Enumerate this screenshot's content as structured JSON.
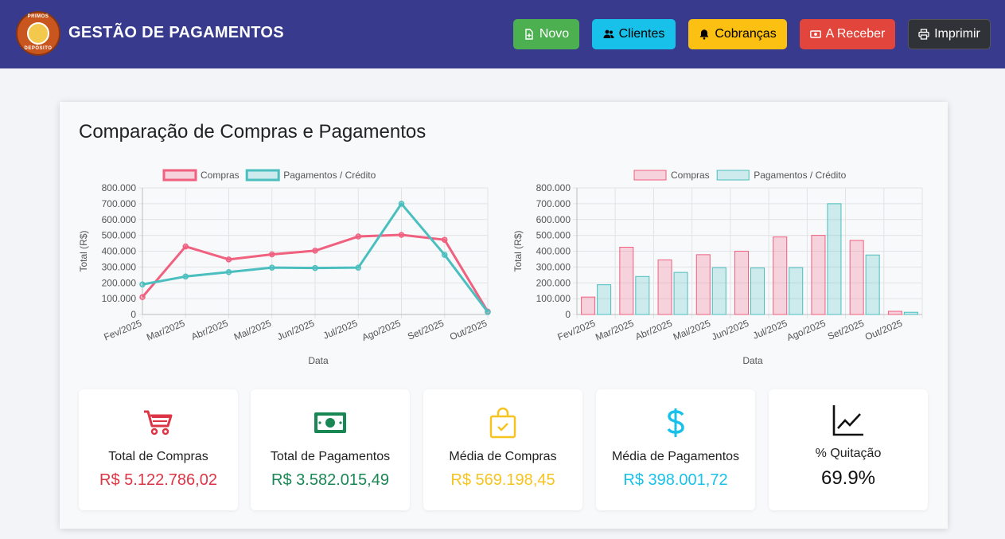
{
  "header": {
    "brand": "GESTÃO DE PAGAMENTOS",
    "logo_text_top": "PRIMOS",
    "logo_text_bottom": "DEPÓSITO",
    "buttons": [
      {
        "label": "Novo",
        "icon": "file-plus-icon"
      },
      {
        "label": "Clientes",
        "icon": "users-icon"
      },
      {
        "label": "Cobranças",
        "icon": "bell-icon"
      },
      {
        "label": "A Receber",
        "icon": "money-bill-icon"
      },
      {
        "label": "Imprimir",
        "icon": "printer-icon"
      }
    ]
  },
  "main": {
    "title": "Comparação de Compras e Pagamentos"
  },
  "chart_data": [
    {
      "type": "line",
      "categories": [
        "Fev/2025",
        "Mar/2025",
        "Abr/2025",
        "Mai/2025",
        "Jun/2025",
        "Jul/2025",
        "Ago/2025",
        "Set/2025",
        "Out/2025"
      ],
      "series": [
        {
          "name": "Compras",
          "color": "#f0607f",
          "values": [
            110000,
            430000,
            348000,
            380000,
            403000,
            493000,
            503000,
            472000,
            18000
          ]
        },
        {
          "name": "Pagamentos / Crédito",
          "color": "#4bbfbf",
          "values": [
            190000,
            240000,
            268000,
            296000,
            294000,
            296000,
            700000,
            377000,
            15000
          ]
        }
      ],
      "xlabel": "Data",
      "ylabel": "Total (R$)",
      "ylim": [
        0,
        800000
      ],
      "yticks": [
        "0",
        "100.000",
        "200.000",
        "300.000",
        "400.000",
        "500.000",
        "600.000",
        "700.000",
        "800.000"
      ],
      "grid": true,
      "legend": "top"
    },
    {
      "type": "bar",
      "categories": [
        "Fev/2025",
        "Mar/2025",
        "Abr/2025",
        "Mai/2025",
        "Jun/2025",
        "Jul/2025",
        "Ago/2025",
        "Set/2025",
        "Out/2025"
      ],
      "series": [
        {
          "name": "Compras",
          "color": "#f0607f",
          "values": [
            110000,
            425000,
            345000,
            378000,
            400000,
            490000,
            500000,
            468000,
            20000
          ]
        },
        {
          "name": "Pagamentos / Crédito",
          "color": "#4bbfbf",
          "values": [
            188000,
            240000,
            266000,
            296000,
            294000,
            296000,
            700000,
            376000,
            14000
          ]
        }
      ],
      "xlabel": "Data",
      "ylabel": "Total (R$)",
      "ylim": [
        0,
        800000
      ],
      "yticks": [
        "0",
        "100.000",
        "200.000",
        "300.000",
        "400.000",
        "500.000",
        "600.000",
        "700.000",
        "800.000"
      ],
      "grid": true,
      "legend": "top"
    }
  ],
  "stats": [
    {
      "label": "Total de Compras",
      "value": "R$ 5.122.786,02",
      "color": "#dc3545",
      "icon": "shopping-cart-icon"
    },
    {
      "label": "Total de Pagamentos",
      "value": "R$ 3.582.015,49",
      "color": "#198754",
      "icon": "money-bill-icon"
    },
    {
      "label": "Média de Compras",
      "value": "R$ 569.198,45",
      "color": "#f7c31f",
      "icon": "shopping-bag-icon"
    },
    {
      "label": "Média de Pagamentos",
      "value": "R$ 398.001,72",
      "color": "#17c1ea",
      "icon": "dollar-icon"
    },
    {
      "label": "% Quitação",
      "value": "69.9%",
      "color": "#111111",
      "icon": "chart-line-icon"
    }
  ]
}
